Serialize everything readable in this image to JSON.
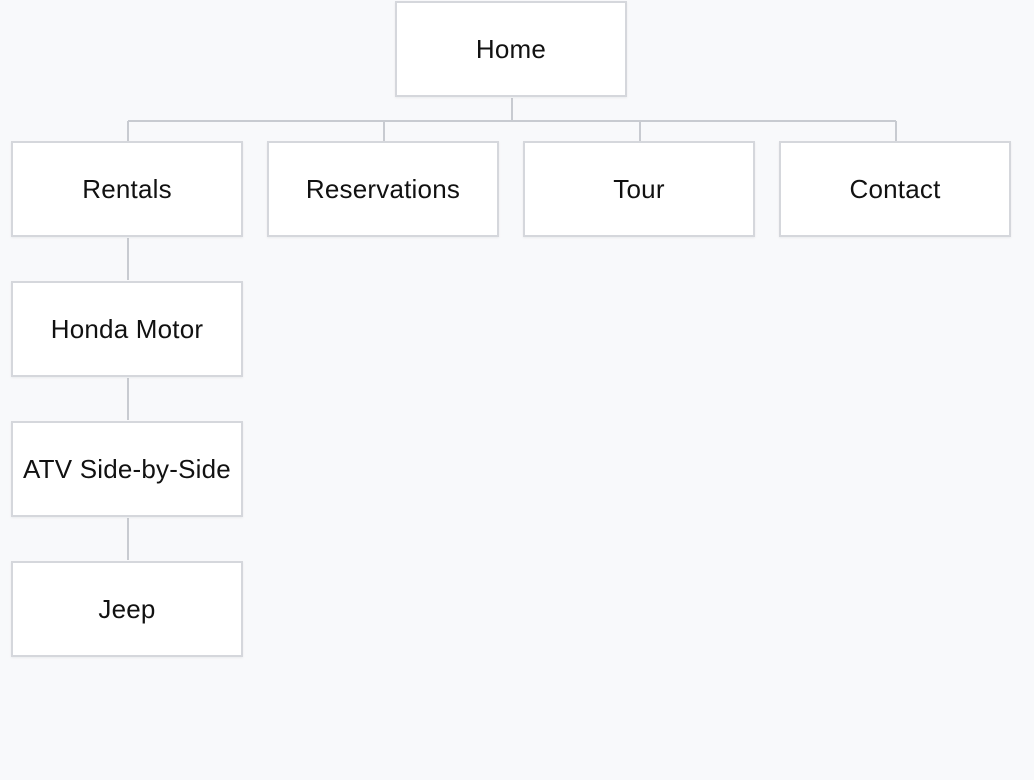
{
  "sitemap": {
    "root": {
      "label": "Home"
    },
    "top_level": [
      {
        "label": "Rentals"
      },
      {
        "label": "Reservations"
      },
      {
        "label": "Tour"
      },
      {
        "label": "Contact"
      }
    ],
    "rentals_children": [
      {
        "label": "Honda Motor"
      },
      {
        "label": "ATV Side-by-Side"
      },
      {
        "label": "Jeep"
      }
    ]
  },
  "colors": {
    "background": "#f8f9fb",
    "node_fill": "#ffffff",
    "node_border": "#d5d7dc",
    "connector": "#c8cbd1",
    "text": "#111111"
  }
}
